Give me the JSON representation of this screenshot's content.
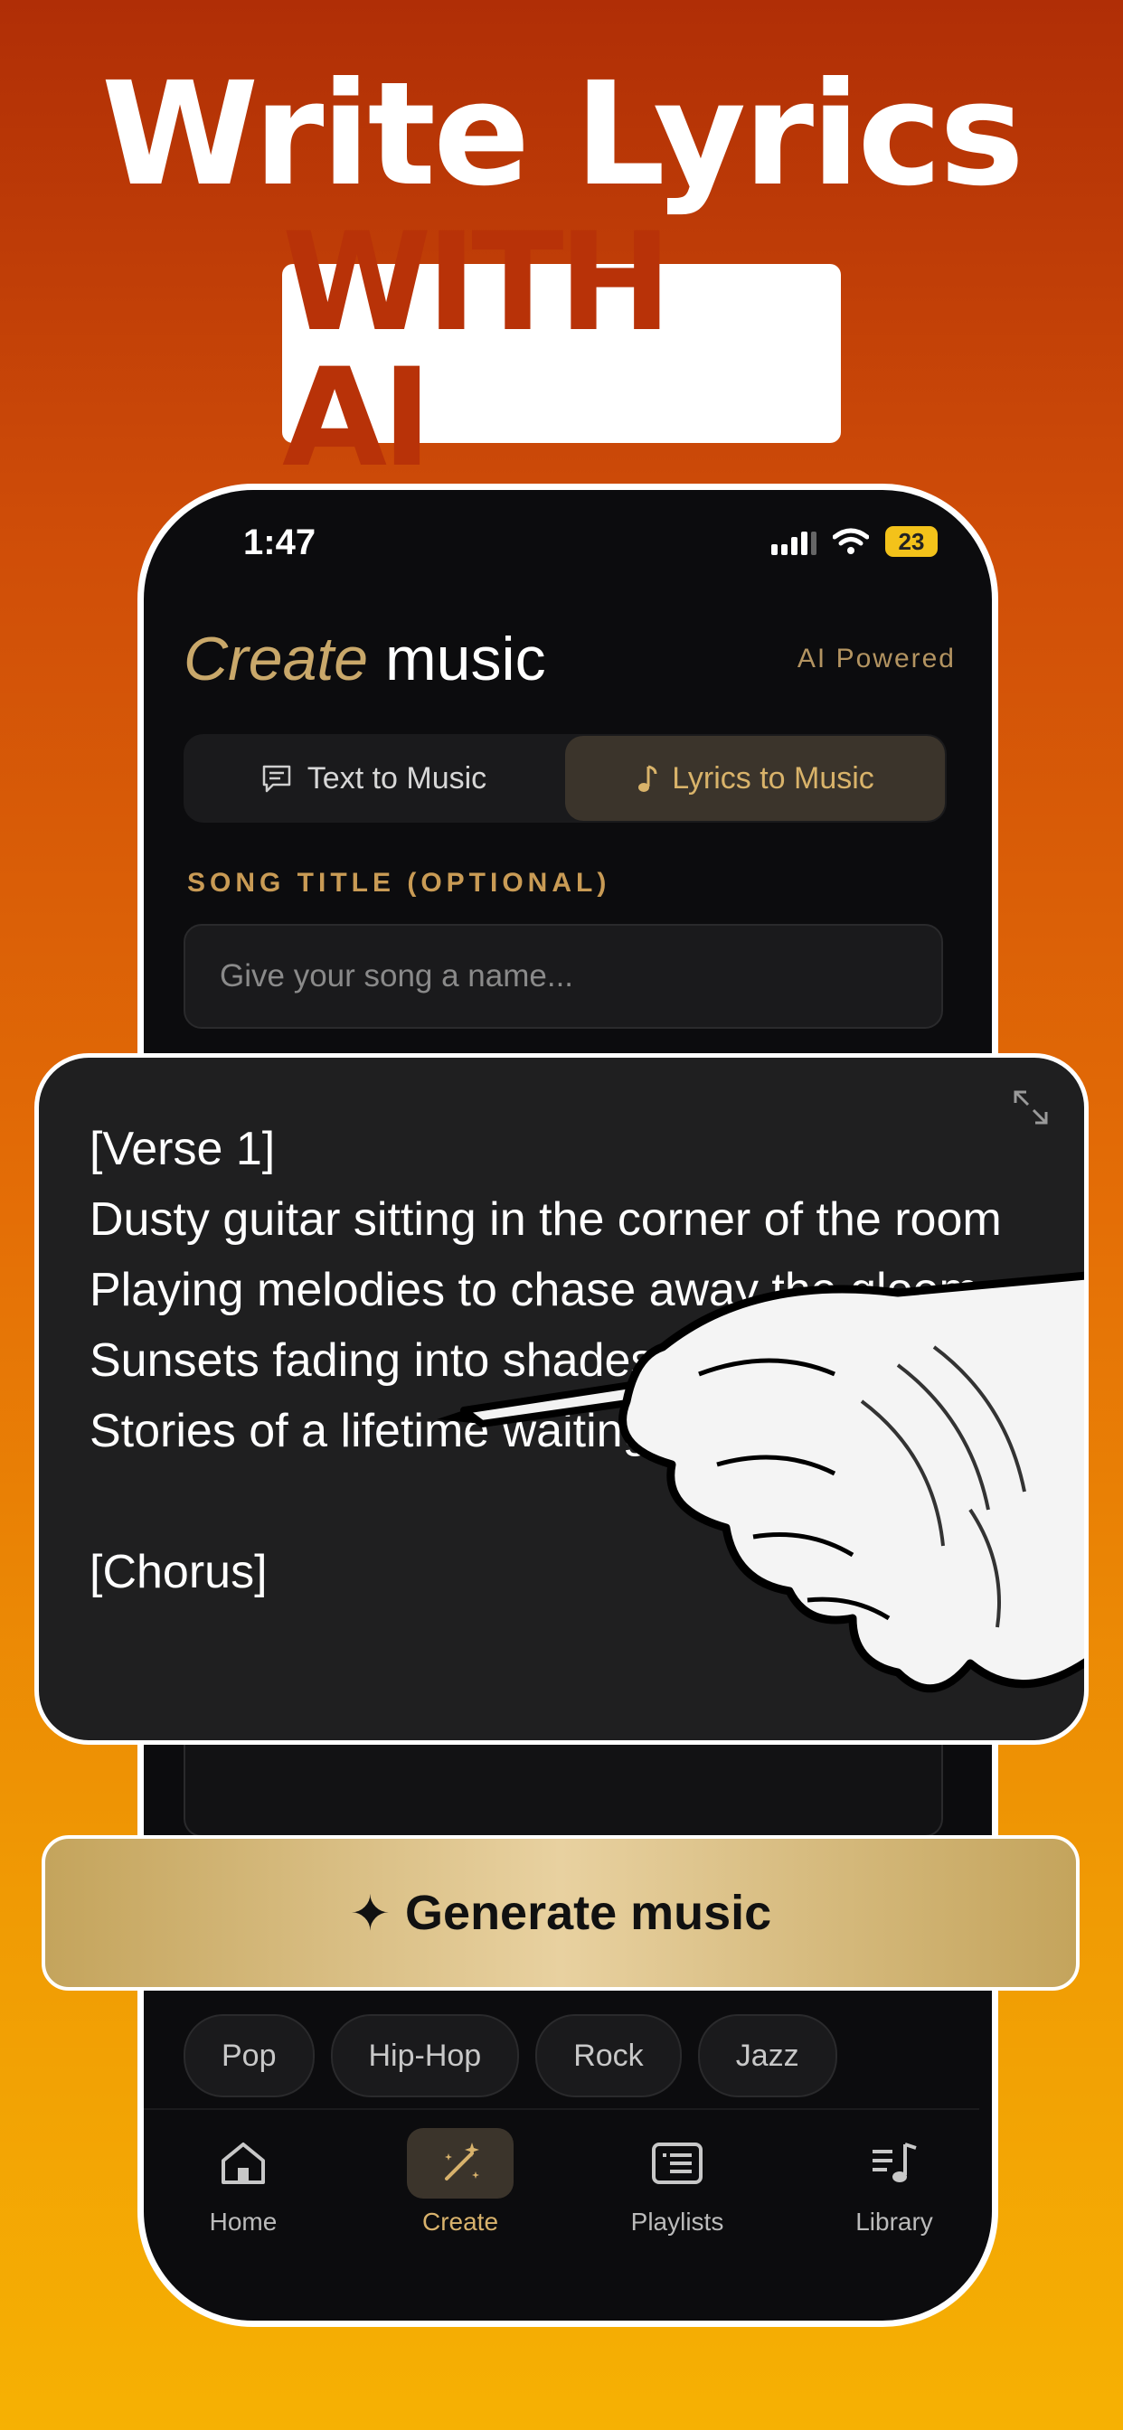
{
  "hero": {
    "headline": "Write Lyrics",
    "highlight": "WITH AI"
  },
  "status_bar": {
    "time": "1:47",
    "battery": "23"
  },
  "header": {
    "title_accent": "Create",
    "title_rest": "music",
    "badge": "AI Powered"
  },
  "mode_tabs": [
    {
      "label": "Text to Music",
      "icon": "chat-icon",
      "selected": false
    },
    {
      "label": "Lyrics to Music",
      "icon": "music-note-icon",
      "selected": true
    }
  ],
  "song_title": {
    "label": "SONG TITLE (OPTIONAL)",
    "placeholder": "Give your song a name..."
  },
  "lyrics": {
    "text": "[Verse 1]\nDusty guitar sitting in the corner of the room\nPlaying melodies to chase away the gloom\nSunsets fading into shades of purple gold\nStories of a lifetime waiting to be told\n\n[Chorus]"
  },
  "generate_button": {
    "icon": "sparkle-icon",
    "icon_glyph": "✦",
    "label": "Generate music"
  },
  "genres": [
    "Pop",
    "Hip-Hop",
    "Rock",
    "Jazz"
  ],
  "nav": [
    {
      "label": "Home",
      "icon": "home-icon",
      "active": false
    },
    {
      "label": "Create",
      "icon": "magic-wand-icon",
      "active": true
    },
    {
      "label": "Playlists",
      "icon": "playlist-icon",
      "active": false
    },
    {
      "label": "Library",
      "icon": "library-icon",
      "active": false
    }
  ],
  "colors": {
    "accent_gold": "#c9a86a",
    "background_orange": "#e46e06",
    "phone_bg": "#0c0c0e"
  }
}
